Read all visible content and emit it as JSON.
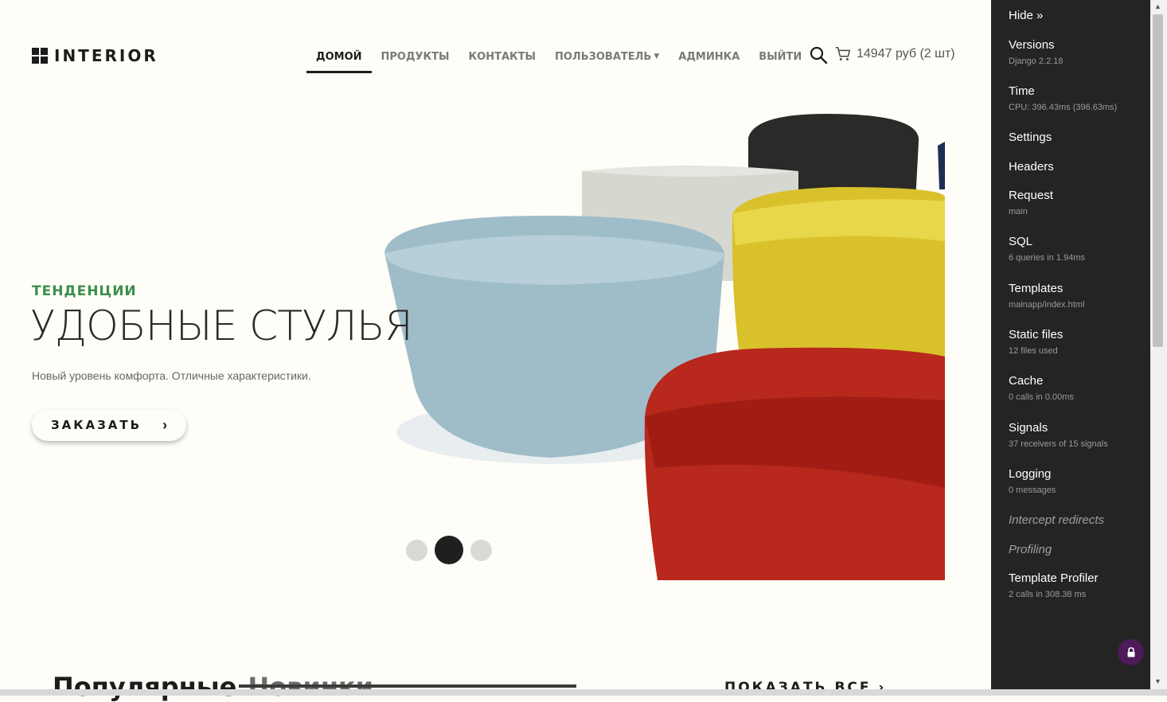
{
  "brand": {
    "name": "INTERIOR"
  },
  "nav": [
    {
      "label": "ДОМОЙ",
      "active": true
    },
    {
      "label": "ПРОДУКТЫ"
    },
    {
      "label": "КОНТАКТЫ"
    },
    {
      "label": "ПОЛЬЗОВАТЕЛЬ",
      "dropdown": true
    },
    {
      "label": "АДМИНКА"
    },
    {
      "label": "ВЫЙТИ"
    }
  ],
  "cart": {
    "summary": "14947 руб (2 шт)"
  },
  "hero": {
    "kicker": "ТЕНДЕНЦИИ",
    "title": "УДОБНЫЕ СТУЛЬЯ",
    "subtitle": "Новый уровень комфорта. Отличные характеристики.",
    "button_label": "ЗАКАЗАТЬ",
    "button_icon": "chevron-right-icon",
    "slides": 3,
    "active_slide": 2
  },
  "section": {
    "title_tab1": "Популярные",
    "title_tab2": "Новинки",
    "show_all": "ПОКАЗАТЬ ВСЕ ›"
  },
  "debug_toolbar": {
    "hide_label": "Hide »",
    "panels": [
      {
        "title": "Versions",
        "sub": "Django 2.2.18",
        "enabled": true
      },
      {
        "title": "Time",
        "sub": "CPU: 396.43ms (396.63ms)",
        "enabled": true
      },
      {
        "title": "Settings",
        "sub": "",
        "enabled": true
      },
      {
        "title": "Headers",
        "sub": "",
        "enabled": true
      },
      {
        "title": "Request",
        "sub": "main",
        "enabled": true
      },
      {
        "title": "SQL",
        "sub": "6 queries in 1.94ms",
        "enabled": true
      },
      {
        "title": "Templates",
        "sub": "mainapp/index.html",
        "enabled": true
      },
      {
        "title": "Static files",
        "sub": "12 files used",
        "enabled": true
      },
      {
        "title": "Cache",
        "sub": "0 calls in 0.00ms",
        "enabled": true
      },
      {
        "title": "Signals",
        "sub": "37 receivers of 15 signals",
        "enabled": true
      },
      {
        "title": "Logging",
        "sub": "0 messages",
        "enabled": true
      },
      {
        "title": "Intercept redirects",
        "sub": "",
        "enabled": false
      },
      {
        "title": "Profiling",
        "sub": "",
        "enabled": false
      },
      {
        "title": "Template Profiler",
        "sub": "2 calls in 308.38 ms",
        "enabled": true
      }
    ]
  },
  "colors": {
    "accent_green": "#3a8f4c",
    "page_bg": "#fffdf7",
    "toolbar_bg": "#242424",
    "checkbox_blue": "#2f7fe6"
  }
}
